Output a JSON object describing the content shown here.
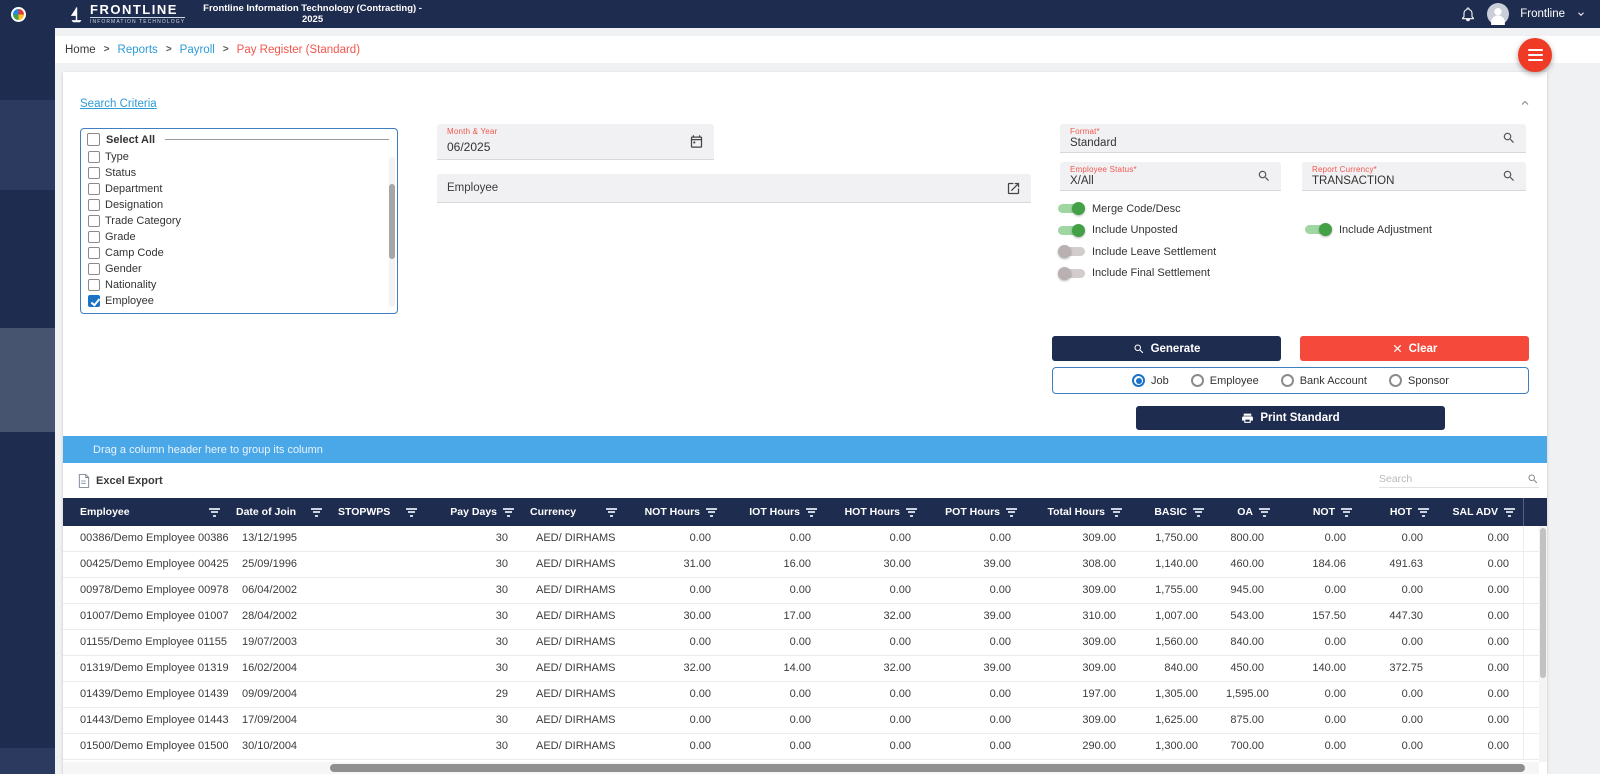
{
  "colors": {
    "navy": "#1e2c4f",
    "link_blue": "#2e9bd6",
    "active_red": "#f2564d",
    "group_bar_blue": "#4aa7e8",
    "button_red": "#f4493b",
    "toggle_green": "#43a047",
    "checkbox_blue": "#1a73c7",
    "fab_red": "#ef3b25"
  },
  "topbar": {
    "brand_name": "FRONTLINE",
    "brand_subtitle": "INFORMATION TECHNOLOGY",
    "company_title_line1": "Frontline Information Technology (Contracting) -",
    "company_title_line2": "2025",
    "user_name": "Frontline"
  },
  "breadcrumb": {
    "separator": ">",
    "items": [
      "Home",
      "Reports",
      "Payroll",
      "Pay Register (Standard)"
    ]
  },
  "criteria": {
    "title": "Search Criteria",
    "select_all": "Select All",
    "filters": [
      {
        "label": "Type",
        "checked": false
      },
      {
        "label": "Status",
        "checked": false
      },
      {
        "label": "Department",
        "checked": false
      },
      {
        "label": "Designation",
        "checked": false
      },
      {
        "label": "Trade Category",
        "checked": false
      },
      {
        "label": "Grade",
        "checked": false
      },
      {
        "label": "Camp Code",
        "checked": false
      },
      {
        "label": "Gender",
        "checked": false
      },
      {
        "label": "Nationality",
        "checked": false
      },
      {
        "label": "Employee",
        "checked": true
      }
    ],
    "month_year": {
      "label": "Month & Year",
      "value": "06/2025"
    },
    "employee_picker": {
      "label": "Employee"
    },
    "format": {
      "label": "Format*",
      "value": "Standard"
    },
    "employee_status": {
      "label": "Employee Status*",
      "value": "X/All"
    },
    "report_currency": {
      "label": "Report Currency*",
      "value": "TRANSACTION"
    },
    "toggles_left": [
      {
        "label": "Merge Code/Desc",
        "on": true
      },
      {
        "label": "Include Unposted",
        "on": true
      },
      {
        "label": "Include Leave Settlement",
        "on": false
      },
      {
        "label": "Include Final Settlement",
        "on": false
      }
    ],
    "toggles_right": [
      {
        "label": "Include Adjustment",
        "on": true
      }
    ],
    "generate_label": "Generate",
    "clear_label": "Clear",
    "print_label": "Print Standard",
    "radios": [
      {
        "label": "Job",
        "selected": true
      },
      {
        "label": "Employee",
        "selected": false
      },
      {
        "label": "Bank Account",
        "selected": false
      },
      {
        "label": "Sponsor",
        "selected": false
      }
    ]
  },
  "grid": {
    "group_hint": "Drag a column header here to group its column",
    "excel_export": "Excel Export",
    "search_placeholder": "Search",
    "columns": [
      "Employee",
      "Date of Join",
      "STOPWPS",
      "Pay Days",
      "Currency",
      "NOT Hours",
      "IOT Hours",
      "HOT Hours",
      "POT Hours",
      "Total Hours",
      "BASIC",
      "OA",
      "NOT",
      "HOT",
      "SAL ADV"
    ],
    "rows": [
      [
        "00386/Demo Employee 00386",
        "13/12/1995",
        "",
        "30",
        "AED/ DIRHAMS",
        "0.00",
        "0.00",
        "0.00",
        "0.00",
        "309.00",
        "1,750.00",
        "800.00",
        "0.00",
        "0.00",
        "0.00"
      ],
      [
        "00425/Demo Employee 00425",
        "25/09/1996",
        "",
        "30",
        "AED/ DIRHAMS",
        "31.00",
        "16.00",
        "30.00",
        "39.00",
        "308.00",
        "1,140.00",
        "460.00",
        "184.06",
        "491.63",
        "0.00"
      ],
      [
        "00978/Demo Employee 00978",
        "06/04/2002",
        "",
        "30",
        "AED/ DIRHAMS",
        "0.00",
        "0.00",
        "0.00",
        "0.00",
        "309.00",
        "1,755.00",
        "945.00",
        "0.00",
        "0.00",
        "0.00"
      ],
      [
        "01007/Demo Employee 01007",
        "28/04/2002",
        "",
        "30",
        "AED/ DIRHAMS",
        "30.00",
        "17.00",
        "32.00",
        "39.00",
        "310.00",
        "1,007.00",
        "543.00",
        "157.50",
        "447.30",
        "0.00"
      ],
      [
        "01155/Demo Employee 01155",
        "19/07/2003",
        "",
        "30",
        "AED/ DIRHAMS",
        "0.00",
        "0.00",
        "0.00",
        "0.00",
        "309.00",
        "1,560.00",
        "840.00",
        "0.00",
        "0.00",
        "0.00"
      ],
      [
        "01319/Demo Employee 01319",
        "16/02/2004",
        "",
        "30",
        "AED/ DIRHAMS",
        "32.00",
        "14.00",
        "32.00",
        "39.00",
        "309.00",
        "840.00",
        "450.00",
        "140.00",
        "372.75",
        "0.00"
      ],
      [
        "01439/Demo Employee 01439",
        "09/09/2004",
        "",
        "29",
        "AED/ DIRHAMS",
        "0.00",
        "0.00",
        "0.00",
        "0.00",
        "197.00",
        "1,305.00",
        "1,595.00",
        "0.00",
        "0.00",
        "0.00"
      ],
      [
        "01443/Demo Employee 01443",
        "17/09/2004",
        "",
        "30",
        "AED/ DIRHAMS",
        "0.00",
        "0.00",
        "0.00",
        "0.00",
        "309.00",
        "1,625.00",
        "875.00",
        "0.00",
        "0.00",
        "0.00"
      ],
      [
        "01500/Demo Employee 01500",
        "30/10/2004",
        "",
        "30",
        "AED/ DIRHAMS",
        "0.00",
        "0.00",
        "0.00",
        "0.00",
        "290.00",
        "1,300.00",
        "700.00",
        "0.00",
        "0.00",
        "0.00"
      ]
    ]
  }
}
